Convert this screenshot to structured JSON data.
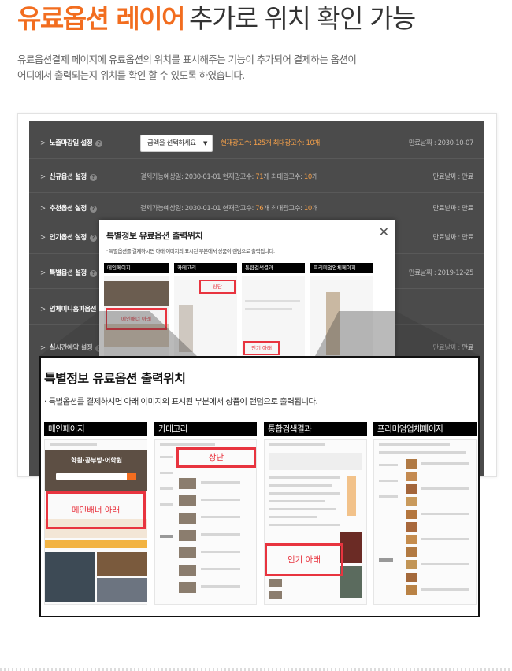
{
  "header": {
    "title_accent": "유료옵션 레이어",
    "title_rest": "추가로 위치 확인 가능",
    "desc_line1": "유료옵션결제 페이지에 유료옵션의 위치를 표시해주는 기능이 추가되어 결제하는 옵션이",
    "desc_line2": "어디에서 출력되는지 위치를 확인 할 수 있도록 하였습니다."
  },
  "panel": {
    "rows": [
      {
        "label": "노출마감일 설정",
        "select": "금액을 선택하세요",
        "info": "현재광고수: 125개  최대광고수: 10개",
        "date": "만료날짜 : 2030-10-07"
      },
      {
        "label": "신규옵션 설정",
        "info_pre": "결제가능예상일: 2030-01-01   현재광고수: ",
        "info_count": "71",
        "info_mid": "개   최대광고수: ",
        "info_max": "10",
        "info_post": "개",
        "date": "만료날짜 : 만료"
      },
      {
        "label": "추천옵션 설정",
        "info_pre": "결제가능예상일: 2030-01-01   현재광고수: ",
        "info_count": "76",
        "info_mid": "개   최대광고수: ",
        "info_max": "10",
        "info_post": "개",
        "date": "만료날짜 : 만료"
      },
      {
        "label": "인기옵션 설정",
        "date": "만료날짜 : 만료"
      },
      {
        "label": "특별옵션 설정",
        "date": "만료날짜 : 2019-12-25"
      },
      {
        "label": "업체미니홈피옵션",
        "date": ""
      },
      {
        "label": "실시간예약 설정",
        "date": "만료날짜 : 만료"
      }
    ],
    "help_glyph": "?",
    "arrow_glyph": ">"
  },
  "popup": {
    "title": "특별정보 유료옵션 출력위치",
    "desc": "· 특별옵션를 결제하시면 아래 이미지의 표시된 부분에서 상품이 랜덤으로 출력됩니다.",
    "close_glyph": "✕",
    "tabs": [
      "메인페이지",
      "카테고리",
      "통합검색결과",
      "프리미엄업체페이지"
    ],
    "labels": {
      "main_banner": "메인배너 아래",
      "top": "상단",
      "popular": "인기 아래",
      "main_banner_sm": "메인배너 아래",
      "top_sm": "상단",
      "popular_sm": "인기 아래"
    },
    "main_hero_text": "학원·공부방·어학원"
  },
  "colors": {
    "accent": "#f26d1f",
    "highlight": "#e8343f",
    "panel_bg": "#4b4b4b"
  }
}
